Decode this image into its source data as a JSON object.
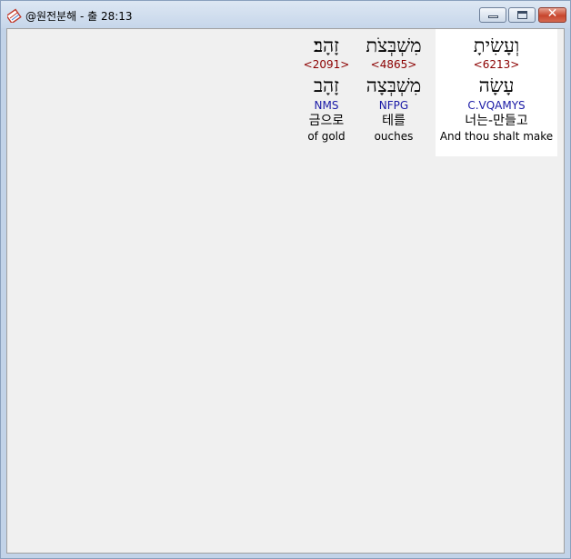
{
  "window": {
    "title": "@원전분해 - 출 28:13",
    "icon": "bible-book-icon",
    "buttons": {
      "minimize": "minimize-icon",
      "maximize": "maximize-icon",
      "close": "close-icon"
    }
  },
  "words": [
    {
      "hebrew": "וְעָשִׂיתָ",
      "strong": "<6213>",
      "lemma": "עָשָׂה",
      "parsing": "C.VQAMYS",
      "korean": "너는-만들고",
      "english": "And thou shalt make",
      "highlighted": true
    },
    {
      "hebrew": "מִשְׁבְּצֹת",
      "strong": "<4865>",
      "lemma": "מִשְׁבְּצָה",
      "parsing": "NFPG",
      "korean": "테를",
      "english": "ouches",
      "highlighted": false
    },
    {
      "hebrew": "זָהָב׃",
      "strong": "<2091>",
      "lemma": "זָהָב",
      "parsing": "NMS",
      "korean": "금으로",
      "english": "of gold",
      "highlighted": false
    }
  ],
  "colors": {
    "strong": "#8b0000",
    "parsing": "#1a1aa6",
    "highlight": "#ffffff"
  }
}
